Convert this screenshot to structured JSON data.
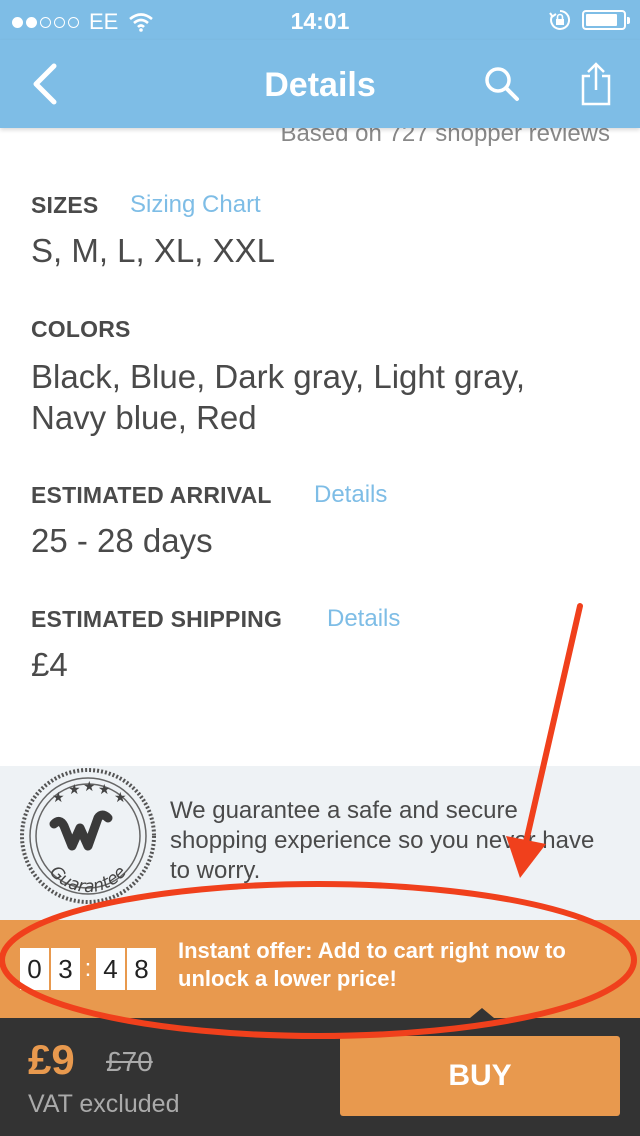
{
  "status_bar": {
    "carrier": "EE",
    "time": "14:01",
    "signal_dots_filled": 2,
    "signal_dots_total": 5,
    "battery_level": 0.85
  },
  "nav": {
    "title": "Details",
    "back_icon": "chevron-left-icon",
    "search_icon": "search-icon",
    "share_icon": "share-icon"
  },
  "reviews": {
    "text": "Based on 727 shopper reviews"
  },
  "sizes": {
    "label": "SIZES",
    "link": "Sizing Chart",
    "value": "S, M, L, XL, XXL"
  },
  "colors": {
    "label": "COLORS",
    "value_line1": "Black, Blue, Dark gray, Light gray,",
    "value_line2": "Navy blue, Red"
  },
  "arrival": {
    "label": "ESTIMATED ARRIVAL",
    "link": "Details",
    "value": "25 - 28 days"
  },
  "shipping": {
    "label": "ESTIMATED SHIPPING",
    "link": "Details",
    "value": "£4"
  },
  "guarantee": {
    "badge_word": "Guarantee",
    "text": "We guarantee a safe and secure shopping experience so you never have to worry."
  },
  "offer": {
    "timer_digits": [
      "0",
      "3",
      "4",
      "8"
    ],
    "timer_separator": ":",
    "text": "Instant offer: Add to cart right now to unlock a lower price!"
  },
  "purchase": {
    "price": "£9",
    "old_price": "£70",
    "vat_note": "VAT excluded",
    "buy_label": "BUY"
  },
  "colors_theme": {
    "header": "#7ebde6",
    "accent": "#e8994e",
    "bottom_bar": "#333333",
    "annotation": "#f0401c"
  }
}
